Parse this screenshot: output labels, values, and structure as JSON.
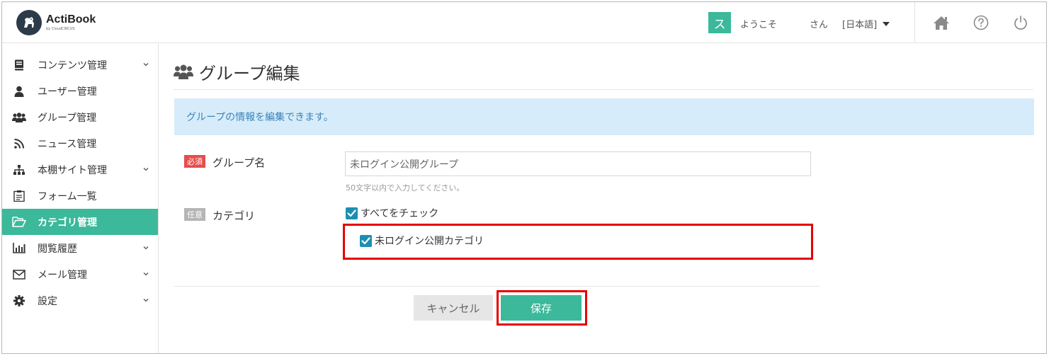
{
  "header": {
    "logo_name": "ActiBook",
    "logo_sub": "by CloudCIRCUS",
    "avatar_initial": "ス",
    "welcome": "ようこそ",
    "san": "さん",
    "language": "[日本語]"
  },
  "sidebar": {
    "items": [
      {
        "label": "コンテンツ管理",
        "icon": "book-icon",
        "has_chevron": true
      },
      {
        "label": "ユーザー管理",
        "icon": "user-icon",
        "has_chevron": false
      },
      {
        "label": "グループ管理",
        "icon": "users-icon",
        "has_chevron": false
      },
      {
        "label": "ニュース管理",
        "icon": "rss-icon",
        "has_chevron": false
      },
      {
        "label": "本棚サイト管理",
        "icon": "sitemap-icon",
        "has_chevron": true
      },
      {
        "label": "フォーム一覧",
        "icon": "form-icon",
        "has_chevron": false
      },
      {
        "label": "カテゴリ管理",
        "icon": "folder-open-icon",
        "has_chevron": false,
        "active": true
      },
      {
        "label": "閲覧履歴",
        "icon": "bar-chart-icon",
        "has_chevron": true
      },
      {
        "label": "メール管理",
        "icon": "envelope-icon",
        "has_chevron": true
      },
      {
        "label": "設定",
        "icon": "gear-icon",
        "has_chevron": true
      }
    ]
  },
  "main": {
    "title": "グループ編集",
    "info": "グループの情報を編集できます。",
    "group_name": {
      "badge": "必須",
      "label": "グループ名",
      "value": "未ログイン公開グループ",
      "help": "50文字以内で入力してください。"
    },
    "category": {
      "badge": "任意",
      "label": "カテゴリ",
      "check_all": "すべてをチェック",
      "items": [
        "未ログイン公開カテゴリ"
      ]
    },
    "buttons": {
      "cancel": "キャンセル",
      "save": "保存"
    }
  },
  "colors": {
    "accent": "#3bb99a",
    "checkbox": "#1b8fb3",
    "info_bg": "#d7ecfa",
    "required_badge": "#e74c4c",
    "highlight": "#e60000"
  }
}
